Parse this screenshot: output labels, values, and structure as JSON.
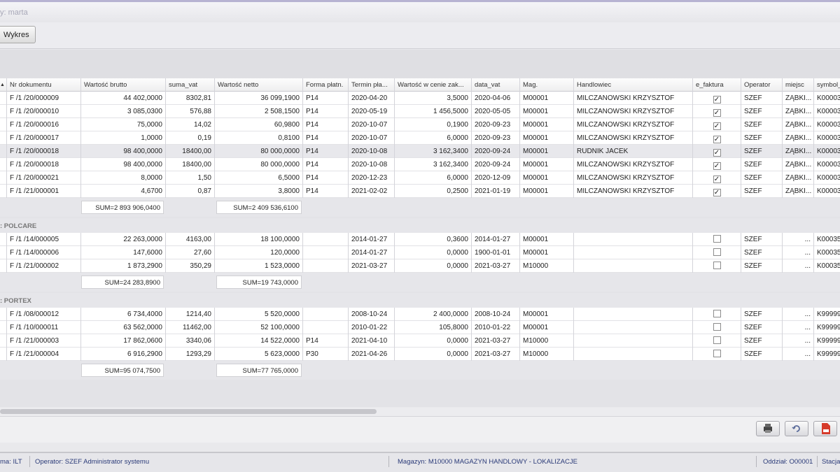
{
  "window": {
    "title": "y: marta"
  },
  "toolbar": {
    "wykres_label": "Wykres"
  },
  "columns": [
    "Nr dokumentu",
    "Wartość brutto",
    "suma_vat",
    "Wartość netto",
    "Forma płatn.",
    "Termin pła...",
    "Wartość w cenie zak...",
    "data_vat",
    "Mag.",
    "Handlowiec",
    "e_faktura",
    "Operator",
    "miejsc",
    "symbol_"
  ],
  "groups": [
    {
      "header": "",
      "rows": [
        {
          "nr": "F /1 /20/000009",
          "brutto": "44 402,0000",
          "vat": "8302,81",
          "netto": "36 099,1900",
          "forma": "P14",
          "termin": "2020-04-20",
          "zak": "3,5000",
          "data_vat": "2020-04-06",
          "mag": "M00001",
          "handlowiec": "MILCZANOWSKI KRZYSZTOF",
          "ef": "✓",
          "operator": "SZEF",
          "miejsc": "ZĄBKI...",
          "symbol": "K00003"
        },
        {
          "nr": "F /1 /20/000010",
          "brutto": "3 085,0300",
          "vat": "576,88",
          "netto": "2 508,1500",
          "forma": "P14",
          "termin": "2020-05-19",
          "zak": "1 456,5000",
          "data_vat": "2020-05-05",
          "mag": "M00001",
          "handlowiec": "MILCZANOWSKI KRZYSZTOF",
          "ef": "✓",
          "operator": "SZEF",
          "miejsc": "ZĄBKI...",
          "symbol": "K00003"
        },
        {
          "nr": "F /1 /20/000016",
          "brutto": "75,0000",
          "vat": "14,02",
          "netto": "60,9800",
          "forma": "P14",
          "termin": "2020-10-07",
          "zak": "0,1900",
          "data_vat": "2020-09-23",
          "mag": "M00001",
          "handlowiec": "MILCZANOWSKI KRZYSZTOF",
          "ef": "✓",
          "operator": "SZEF",
          "miejsc": "ZĄBKI...",
          "symbol": "K00003"
        },
        {
          "nr": "F /1 /20/000017",
          "brutto": "1,0000",
          "vat": "0,19",
          "netto": "0,8100",
          "forma": "P14",
          "termin": "2020-10-07",
          "zak": "6,0000",
          "data_vat": "2020-09-23",
          "mag": "M00001",
          "handlowiec": "MILCZANOWSKI KRZYSZTOF",
          "ef": "✓",
          "operator": "SZEF",
          "miejsc": "ZĄBKI...",
          "symbol": "K00003"
        },
        {
          "nr": "F /1 /20/000018",
          "brutto": "98 400,0000",
          "vat": "18400,00",
          "netto": "80 000,0000",
          "forma": "P14",
          "termin": "2020-10-08",
          "zak": "3 162,3400",
          "data_vat": "2020-09-24",
          "mag": "M00001",
          "handlowiec": "RUDNIK JACEK",
          "ef": "✓",
          "operator": "SZEF",
          "miejsc": "ZĄBKI...",
          "symbol": "K00003",
          "selected": true
        },
        {
          "nr": "F /1 /20/000018",
          "brutto": "98 400,0000",
          "vat": "18400,00",
          "netto": "80 000,0000",
          "forma": "P14",
          "termin": "2020-10-08",
          "zak": "3 162,3400",
          "data_vat": "2020-09-24",
          "mag": "M00001",
          "handlowiec": "MILCZANOWSKI KRZYSZTOF",
          "ef": "✓",
          "operator": "SZEF",
          "miejsc": "ZĄBKI...",
          "symbol": "K00003"
        },
        {
          "nr": "F /1 /20/000021",
          "brutto": "8,0000",
          "vat": "1,50",
          "netto": "6,5000",
          "forma": "P14",
          "termin": "2020-12-23",
          "zak": "6,0000",
          "data_vat": "2020-12-09",
          "mag": "M00001",
          "handlowiec": "MILCZANOWSKI KRZYSZTOF",
          "ef": "✓",
          "operator": "SZEF",
          "miejsc": "ZĄBKI...",
          "symbol": "K00003"
        },
        {
          "nr": "F /1 /21/000001",
          "brutto": "4,6700",
          "vat": "0,87",
          "netto": "3,8000",
          "forma": "P14",
          "termin": "2021-02-02",
          "zak": "0,2500",
          "data_vat": "2021-01-19",
          "mag": "M00001",
          "handlowiec": "MILCZANOWSKI KRZYSZTOF",
          "ef": "✓",
          "operator": "SZEF",
          "miejsc": "ZĄBKI...",
          "symbol": "K00003"
        }
      ],
      "sum_brutto": "SUM=2 893 906,0400",
      "sum_netto": "SUM=2 409 536,6100"
    },
    {
      "header": ": POLCARE",
      "rows": [
        {
          "nr": "F /1 /14/000005",
          "brutto": "22 263,0000",
          "vat": "4163,00",
          "netto": "18 100,0000",
          "forma": "",
          "termin": "2014-01-27",
          "zak": "0,3600",
          "data_vat": "2014-01-27",
          "mag": "M00001",
          "handlowiec": "",
          "ef": "",
          "operator": "SZEF",
          "miejsc": "...",
          "symbol": "K00035"
        },
        {
          "nr": "F /1 /14/000006",
          "brutto": "147,6000",
          "vat": "27,60",
          "netto": "120,0000",
          "forma": "",
          "termin": "2014-01-27",
          "zak": "0,0000",
          "data_vat": "1900-01-01",
          "mag": "M00001",
          "handlowiec": "",
          "ef": "",
          "operator": "SZEF",
          "miejsc": "...",
          "symbol": "K00035"
        },
        {
          "nr": "F /1 /21/000002",
          "brutto": "1 873,2900",
          "vat": "350,29",
          "netto": "1 523,0000",
          "forma": "",
          "termin": "2021-03-27",
          "zak": "0,0000",
          "data_vat": "2021-03-27",
          "mag": "M10000",
          "handlowiec": "",
          "ef": "",
          "operator": "SZEF",
          "miejsc": "...",
          "symbol": "K00035"
        }
      ],
      "sum_brutto": "SUM=24 283,8900",
      "sum_netto": "SUM=19 743,0000"
    },
    {
      "header": ": PORTEX",
      "rows": [
        {
          "nr": "F /1 /08/000012",
          "brutto": "6 734,4000",
          "vat": "1214,40",
          "netto": "5 520,0000",
          "forma": "",
          "termin": "2008-10-24",
          "zak": "2 400,0000",
          "data_vat": "2008-10-24",
          "mag": "M00001",
          "handlowiec": "",
          "ef": "",
          "operator": "SZEF",
          "miejsc": "...",
          "symbol": "K99999"
        },
        {
          "nr": "F /1 /10/000011",
          "brutto": "63 562,0000",
          "vat": "11462,00",
          "netto": "52 100,0000",
          "forma": "",
          "termin": "2010-01-22",
          "zak": "105,8000",
          "data_vat": "2010-01-22",
          "mag": "M00001",
          "handlowiec": "",
          "ef": "",
          "operator": "SZEF",
          "miejsc": "...",
          "symbol": "K99999"
        },
        {
          "nr": "F /1 /21/000003",
          "brutto": "17 862,0600",
          "vat": "3340,06",
          "netto": "14 522,0000",
          "forma": "P14",
          "termin": "2021-04-10",
          "zak": "0,0000",
          "data_vat": "2021-03-27",
          "mag": "M10000",
          "handlowiec": "",
          "ef": "",
          "operator": "SZEF",
          "miejsc": "...",
          "symbol": "K99999"
        },
        {
          "nr": "F /1 /21/000004",
          "brutto": "6 916,2900",
          "vat": "1293,29",
          "netto": "5 623,0000",
          "forma": "P30",
          "termin": "2021-04-26",
          "zak": "0,0000",
          "data_vat": "2021-03-27",
          "mag": "M10000",
          "handlowiec": "",
          "ef": "",
          "operator": "SZEF",
          "miejsc": "...",
          "symbol": "K99999"
        }
      ],
      "sum_brutto": "SUM=95 074,7500",
      "sum_netto": "SUM=77 765,0000"
    }
  ],
  "status": {
    "firma": "ma: ILT",
    "operator": "Operator: SZEF Administrator systemu",
    "magazyn": "Magazyn: M10000 MAGAZYN HANDLOWY - LOKALIZACJE",
    "oddzial": "Oddział: O00001",
    "stacja": "Stacja"
  },
  "icons": {
    "print": "printer-icon",
    "refresh": "refresh-icon",
    "pdf": "pdf-icon"
  }
}
